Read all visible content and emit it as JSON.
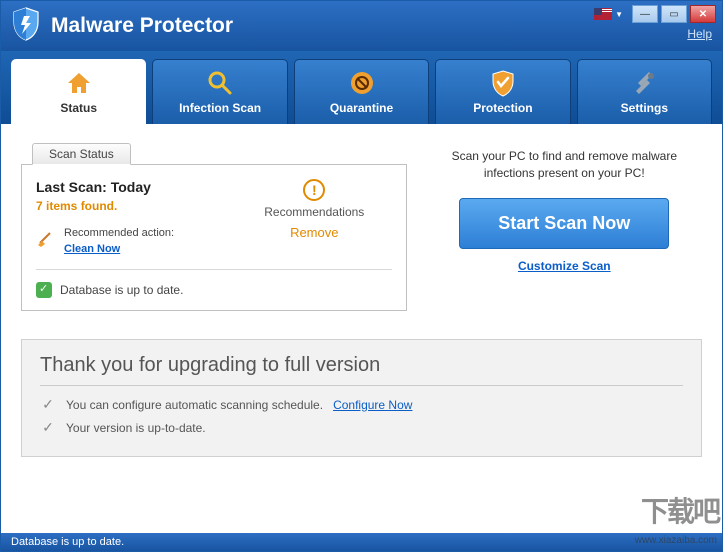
{
  "header": {
    "title": "Malware Protector",
    "help_label": "Help"
  },
  "tabs": [
    {
      "label": "Status"
    },
    {
      "label": "Infection Scan"
    },
    {
      "label": "Quarantine"
    },
    {
      "label": "Protection"
    },
    {
      "label": "Settings"
    }
  ],
  "status": {
    "tab_label": "Scan Status",
    "last_scan_label": "Last Scan:",
    "last_scan_value": "Today",
    "items_found": "7 items found.",
    "recommended_action_label": "Recommended action:",
    "clean_now": "Clean Now",
    "recommendations_label": "Recommendations",
    "remove_label": "Remove",
    "database_status": "Database is up to date."
  },
  "side": {
    "scan_prompt": "Scan your PC to find and remove malware infections present on your PC!",
    "start_scan": "Start Scan Now",
    "customize": "Customize Scan"
  },
  "upgrade": {
    "title": "Thank you for upgrading to full version",
    "line1_prefix": "You can configure automatic scanning schedule.",
    "configure_now": "Configure Now",
    "line2": "Your version is up-to-date."
  },
  "statusbar": {
    "text": "Database is up to date."
  },
  "watermark": {
    "text": "下载吧",
    "url": "www.xiazaiba.com"
  }
}
